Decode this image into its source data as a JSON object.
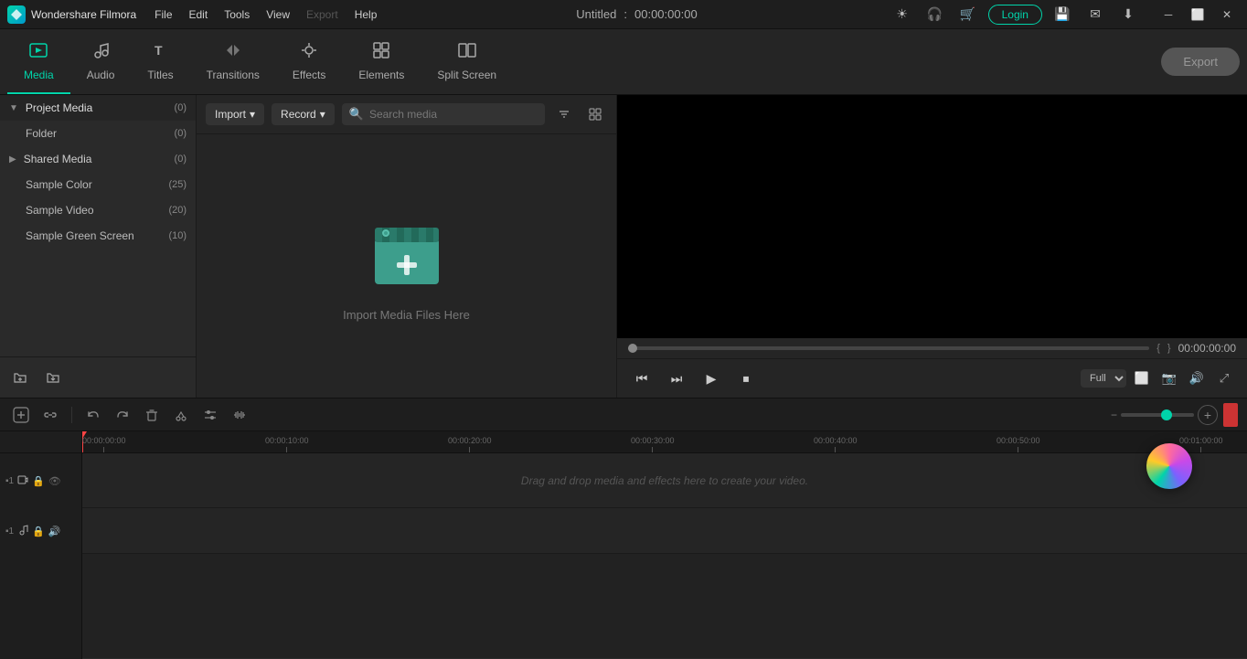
{
  "titlebar": {
    "app_name": "Wondershare Filmora",
    "project_title": "Untitled",
    "timecode": "00:00:00:00",
    "menu_items": [
      "File",
      "Edit",
      "Tools",
      "View",
      "Export",
      "Help"
    ],
    "export_label": "Export",
    "login_label": "Login"
  },
  "toolbar": {
    "tabs": [
      {
        "id": "media",
        "label": "Media",
        "active": true
      },
      {
        "id": "audio",
        "label": "Audio",
        "active": false
      },
      {
        "id": "titles",
        "label": "Titles",
        "active": false
      },
      {
        "id": "transitions",
        "label": "Transitions",
        "active": false
      },
      {
        "id": "effects",
        "label": "Effects",
        "active": false
      },
      {
        "id": "elements",
        "label": "Elements",
        "active": false
      },
      {
        "id": "splitscreen",
        "label": "Split Screen",
        "active": false
      }
    ]
  },
  "left_panel": {
    "section_label": "Project Media",
    "section_count": "(0)",
    "items": [
      {
        "label": "Folder",
        "count": "(0)",
        "indent": true
      },
      {
        "label": "Shared Media",
        "count": "(0)",
        "indent": false,
        "expandable": true
      },
      {
        "label": "Sample Color",
        "count": "(25)",
        "indent": false
      },
      {
        "label": "Sample Video",
        "count": "(20)",
        "indent": false
      },
      {
        "label": "Sample Green Screen",
        "count": "(10)",
        "indent": false
      }
    ],
    "footer_buttons": [
      {
        "name": "new-folder-button",
        "icon": "🗁"
      },
      {
        "name": "import-folder-button",
        "icon": "📁"
      }
    ]
  },
  "media_panel": {
    "import_label": "Import",
    "record_label": "Record",
    "search_placeholder": "Search media",
    "drop_text": "Import Media Files Here"
  },
  "preview": {
    "timecode": "00:00:00:00",
    "quality": "Full",
    "progress": 0
  },
  "timeline": {
    "toolbar_buttons": [
      {
        "name": "add-marker",
        "icon": "+",
        "title": "Add marker"
      },
      {
        "name": "link-toggle",
        "icon": "🔗",
        "title": "Link"
      },
      {
        "name": "delete",
        "icon": "🗑",
        "title": "Delete"
      },
      {
        "name": "cut",
        "icon": "✂",
        "title": "Cut"
      },
      {
        "name": "adjust",
        "icon": "⚙",
        "title": "Adjust"
      },
      {
        "name": "audio-stretch",
        "icon": "≋",
        "title": "Audio stretch"
      }
    ],
    "rulers": [
      "00:00:00:00",
      "00:00:10:00",
      "00:00:20:00",
      "00:00:30:00",
      "00:00:40:00",
      "00:00:50:00",
      "00:01:00:00"
    ],
    "drop_hint": "Drag and drop media and effects here to create your video.",
    "tracks": [
      {
        "num": "1",
        "type": "video",
        "icon": "🎬"
      },
      {
        "num": "1",
        "type": "audio",
        "icon": "🎵"
      }
    ]
  }
}
